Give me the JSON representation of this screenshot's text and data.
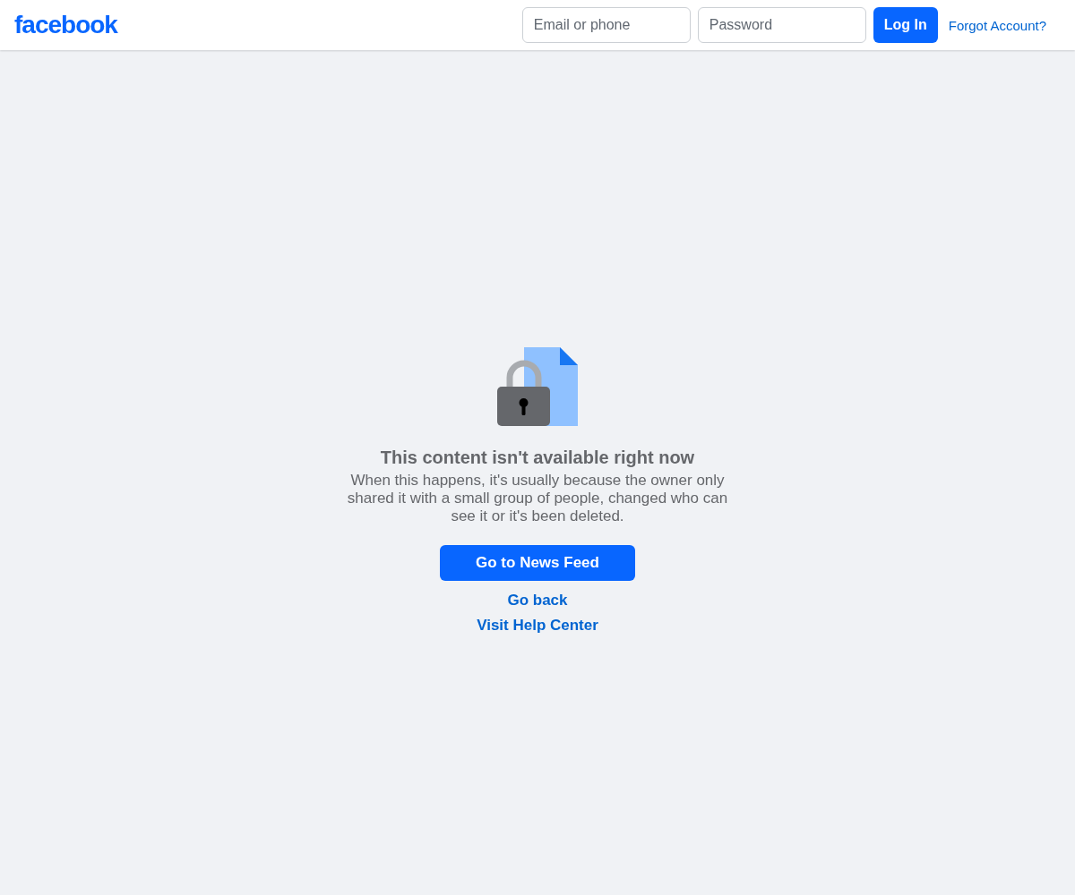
{
  "header": {
    "logo": "facebook",
    "email": {
      "placeholder": "Email or phone"
    },
    "password": {
      "placeholder": "Password"
    },
    "login_button": "Log In",
    "forgot_link": "Forgot Account?"
  },
  "message": {
    "title": "This content isn't available right now",
    "body": "When this happens, it's usually because the owner only shared it with a small group of people, changed who can see it or it's been deleted.",
    "primary_button": "Go to News Feed",
    "links": [
      "Go back",
      "Visit Help Center"
    ]
  }
}
